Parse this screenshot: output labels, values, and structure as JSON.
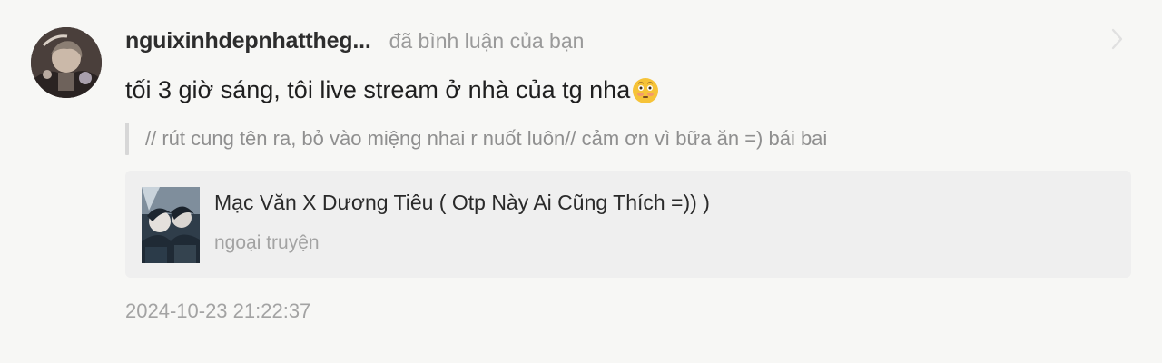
{
  "notification": {
    "username": "nguixinhdepnhattheg...",
    "action_text": "đã bình luận của bạn",
    "comment_text": "tối 3 giờ sáng, tôi live stream ở nhà của tg nha",
    "comment_emoji": "flushed-face-emoji",
    "quoted_text": "// rút cung tên ra, bỏ vào miệng nhai r nuốt luôn// cảm ơn vì bữa ăn =) bái bai",
    "timestamp": "2024-10-23 21:22:37",
    "icons": {
      "avatar": "user-avatar",
      "chevron": "chevron-right-icon"
    }
  },
  "linked_story": {
    "title": "Mạc Văn X Dương Tiêu ( Otp Này Ai Cũng Thích =)) )",
    "subtitle": "ngoại truyện",
    "cover": "story-cover-thumbnail"
  },
  "colors": {
    "background": "#f7f7f5",
    "card_background": "#efefef",
    "username": "#2d2d2d",
    "secondary_text": "#9a9a9a",
    "emoji_face": "#f6c338"
  }
}
